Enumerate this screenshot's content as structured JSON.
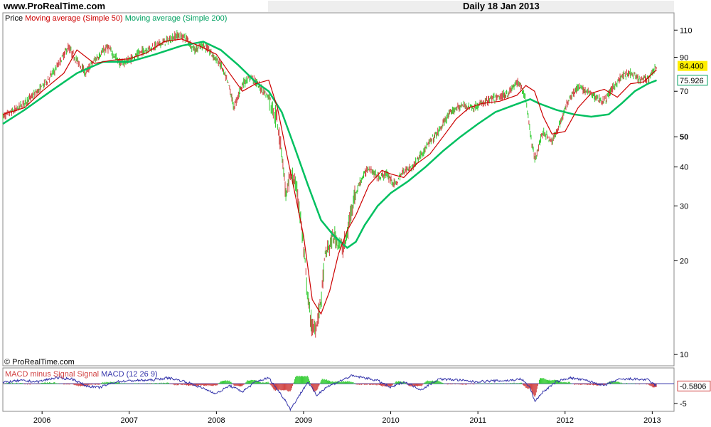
{
  "header": {
    "site": "www.ProRealTime.com",
    "dateline": "Daily  18 Jan 2013"
  },
  "main_legend": {
    "price": "Price",
    "ma50": "Moving average (Simple 50)",
    "ma200": "Moving average (Simple 200)"
  },
  "macd_legend": {
    "macd_minus_signal": "MACD minus Signal",
    "signal": "Signal",
    "macd": "MACD (12 26 9)"
  },
  "copyright": "© ProRealTime.com",
  "colors": {
    "up": "#33cc33",
    "down": "#d04040",
    "ma50": "#cc0000",
    "ma200": "#00c060",
    "macd": "#3333aa",
    "hist_pos": "#33cc33",
    "hist_neg": "#d04040",
    "last_price_bg": "#ffee00",
    "ma200_label": "#00a060"
  },
  "chart_data": [
    {
      "type": "line",
      "title": "Price",
      "scale": "log",
      "ylim": [
        9.2,
        125
      ],
      "yticks": [
        10,
        20,
        30,
        40,
        50,
        70,
        90,
        110
      ],
      "x_year_labels": [
        "2006",
        "2007",
        "2008",
        "2009",
        "2010",
        "2011",
        "2012",
        "2013"
      ],
      "last_price": "84.400",
      "ma200_last": "75.926",
      "series": [
        {
          "name": "Price",
          "x": [
            2005.55,
            2005.7,
            2005.85,
            2006.0,
            2006.15,
            2006.3,
            2006.35,
            2006.5,
            2006.6,
            2006.75,
            2006.9,
            2007.0,
            2007.15,
            2007.3,
            2007.45,
            2007.55,
            2007.65,
            2007.75,
            2007.85,
            2007.95,
            2008.05,
            2008.15,
            2008.2,
            2008.3,
            2008.4,
            2008.5,
            2008.6,
            2008.7,
            2008.75,
            2008.8,
            2008.85,
            2008.9,
            2008.95,
            2009.0,
            2009.05,
            2009.1,
            2009.15,
            2009.2,
            2009.25,
            2009.35,
            2009.45,
            2009.5,
            2009.55,
            2009.65,
            2009.75,
            2009.85,
            2009.95,
            2010.05,
            2010.15,
            2010.25,
            2010.35,
            2010.45,
            2010.55,
            2010.65,
            2010.75,
            2010.85,
            2010.95,
            2011.05,
            2011.15,
            2011.25,
            2011.35,
            2011.45,
            2011.5,
            2011.55,
            2011.6,
            2011.65,
            2011.7,
            2011.75,
            2011.8,
            2011.85,
            2011.95,
            2012.05,
            2012.15,
            2012.25,
            2012.35,
            2012.45,
            2012.55,
            2012.65,
            2012.75,
            2012.85,
            2012.95,
            2013.05
          ],
          "values": [
            58,
            61,
            66,
            72,
            82,
            97,
            92,
            80,
            88,
            97,
            86,
            88,
            94,
            98,
            102,
            106,
            104,
            95,
            99,
            92,
            85,
            72,
            62,
            74,
            78,
            72,
            67,
            56,
            45,
            32,
            38,
            36,
            30,
            22,
            15,
            12,
            12.5,
            15,
            21,
            24,
            22,
            24,
            30,
            36,
            40,
            37,
            38,
            35,
            39,
            40,
            44,
            48,
            52,
            58,
            62,
            63,
            62,
            64,
            66,
            67,
            69,
            75,
            72,
            66,
            52,
            42,
            47,
            52,
            50,
            48,
            56,
            67,
            72,
            70,
            67,
            65,
            72,
            78,
            80,
            76,
            77,
            84.4
          ]
        },
        {
          "name": "Moving average (Simple 50)",
          "x": [
            2005.55,
            2005.8,
            2006.0,
            2006.25,
            2006.4,
            2006.6,
            2006.8,
            2007.0,
            2007.2,
            2007.4,
            2007.6,
            2007.8,
            2008.0,
            2008.15,
            2008.3,
            2008.45,
            2008.6,
            2008.7,
            2008.8,
            2008.9,
            2009.0,
            2009.1,
            2009.2,
            2009.3,
            2009.4,
            2009.5,
            2009.6,
            2009.75,
            2009.9,
            2010.0,
            2010.15,
            2010.3,
            2010.45,
            2010.6,
            2010.75,
            2010.9,
            2011.05,
            2011.25,
            2011.45,
            2011.55,
            2011.65,
            2011.75,
            2011.85,
            2012.0,
            2012.15,
            2012.3,
            2012.45,
            2012.6,
            2012.75,
            2012.9,
            2013.05
          ],
          "values": [
            59,
            62,
            70,
            80,
            95,
            86,
            88,
            89,
            93,
            101,
            103,
            98,
            92,
            80,
            70,
            74,
            76,
            62,
            45,
            33,
            24,
            15,
            13.5,
            16,
            21,
            25,
            28,
            35,
            39,
            38,
            37,
            41,
            44,
            50,
            57,
            62,
            64,
            65,
            68,
            73,
            70,
            58,
            51,
            52,
            62,
            69,
            71,
            67,
            74,
            75,
            82
          ]
        },
        {
          "name": "Moving average (Simple 200)",
          "x": [
            2005.55,
            2005.8,
            2006.1,
            2006.4,
            2006.7,
            2007.0,
            2007.3,
            2007.6,
            2007.85,
            2008.05,
            2008.25,
            2008.45,
            2008.6,
            2008.75,
            2008.9,
            2009.05,
            2009.2,
            2009.35,
            2009.5,
            2009.6,
            2009.7,
            2009.85,
            2010.0,
            2010.2,
            2010.4,
            2010.6,
            2010.8,
            2011.0,
            2011.2,
            2011.4,
            2011.6,
            2011.7,
            2011.9,
            2012.1,
            2012.3,
            2012.5,
            2012.65,
            2012.8,
            2012.95,
            2013.05
          ],
          "values": [
            55,
            61,
            70,
            80,
            87,
            87,
            92,
            98,
            101,
            95,
            85,
            75,
            70,
            60,
            46,
            35,
            27,
            24,
            22,
            23,
            26,
            30,
            33,
            36,
            40,
            45,
            50,
            55,
            60,
            63,
            66,
            64,
            61,
            59,
            58,
            59,
            64,
            70,
            74,
            75.9
          ]
        }
      ]
    },
    {
      "type": "line",
      "title": "MACD (12 26 9)",
      "ylim": [
        -7,
        4
      ],
      "yticks": [
        -5
      ],
      "last_value": "-0.5806",
      "series": [
        {
          "name": "MACD (12 26 9)",
          "x": [
            2005.55,
            2005.75,
            2005.95,
            2006.15,
            2006.35,
            2006.5,
            2006.65,
            2006.85,
            2007.05,
            2007.25,
            2007.45,
            2007.65,
            2007.85,
            2008.0,
            2008.15,
            2008.3,
            2008.45,
            2008.6,
            2008.7,
            2008.8,
            2008.85,
            2008.95,
            2009.05,
            2009.15,
            2009.25,
            2009.4,
            2009.55,
            2009.7,
            2009.85,
            2010.0,
            2010.15,
            2010.35,
            2010.55,
            2010.75,
            2010.95,
            2011.15,
            2011.35,
            2011.5,
            2011.6,
            2011.65,
            2011.75,
            2011.9,
            2012.05,
            2012.25,
            2012.45,
            2012.6,
            2012.75,
            2012.95,
            2013.05
          ],
          "values": [
            0.3,
            0.8,
            0.5,
            1.5,
            1.2,
            -0.5,
            -1.0,
            0.5,
            0.8,
            0.9,
            1.5,
            0.5,
            -1.2,
            -2.5,
            -0.5,
            -2.0,
            0.5,
            1.5,
            -1.5,
            -4.5,
            -6.5,
            -3.0,
            0.5,
            -3.0,
            -1.0,
            0.5,
            2.0,
            1.5,
            0.8,
            -1.0,
            0.5,
            -1.5,
            1.2,
            1.0,
            0.5,
            0.7,
            0.8,
            1.2,
            -1.0,
            -4.5,
            -2.0,
            0.5,
            1.5,
            0.8,
            -0.5,
            1.0,
            1.2,
            1.0,
            -0.6
          ]
        }
      ]
    }
  ]
}
